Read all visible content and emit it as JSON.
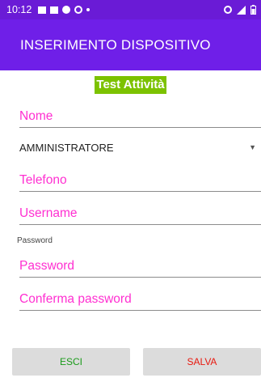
{
  "status_bar": {
    "time": "10:12",
    "left_icons": [
      "notification-square-icon",
      "facebook-icon",
      "circle-icon",
      "sync-icon",
      "dot-icon"
    ],
    "right_icons": [
      "alarm-icon",
      "signal-icon",
      "battery-icon"
    ]
  },
  "app_bar": {
    "title": "INSERIMENTO DISPOSITIVO"
  },
  "form": {
    "badge": "Test Attività",
    "nome_placeholder": "Nome",
    "role_selected": "AMMINISTRATORE",
    "telefono_placeholder": "Telefono",
    "username_placeholder": "Username",
    "password_label": "Password",
    "password_placeholder": "Password",
    "conferma_placeholder": "Conferma password"
  },
  "buttons": {
    "esci": "ESCI",
    "salva": "SALVA"
  },
  "colors": {
    "status_bar": "#6a1bd6",
    "app_bar": "#6f1fe8",
    "badge": "#7cc200",
    "hint": "#ff2fd1",
    "esci_text": "#1a9b1a",
    "salva_text": "#e8190f"
  }
}
